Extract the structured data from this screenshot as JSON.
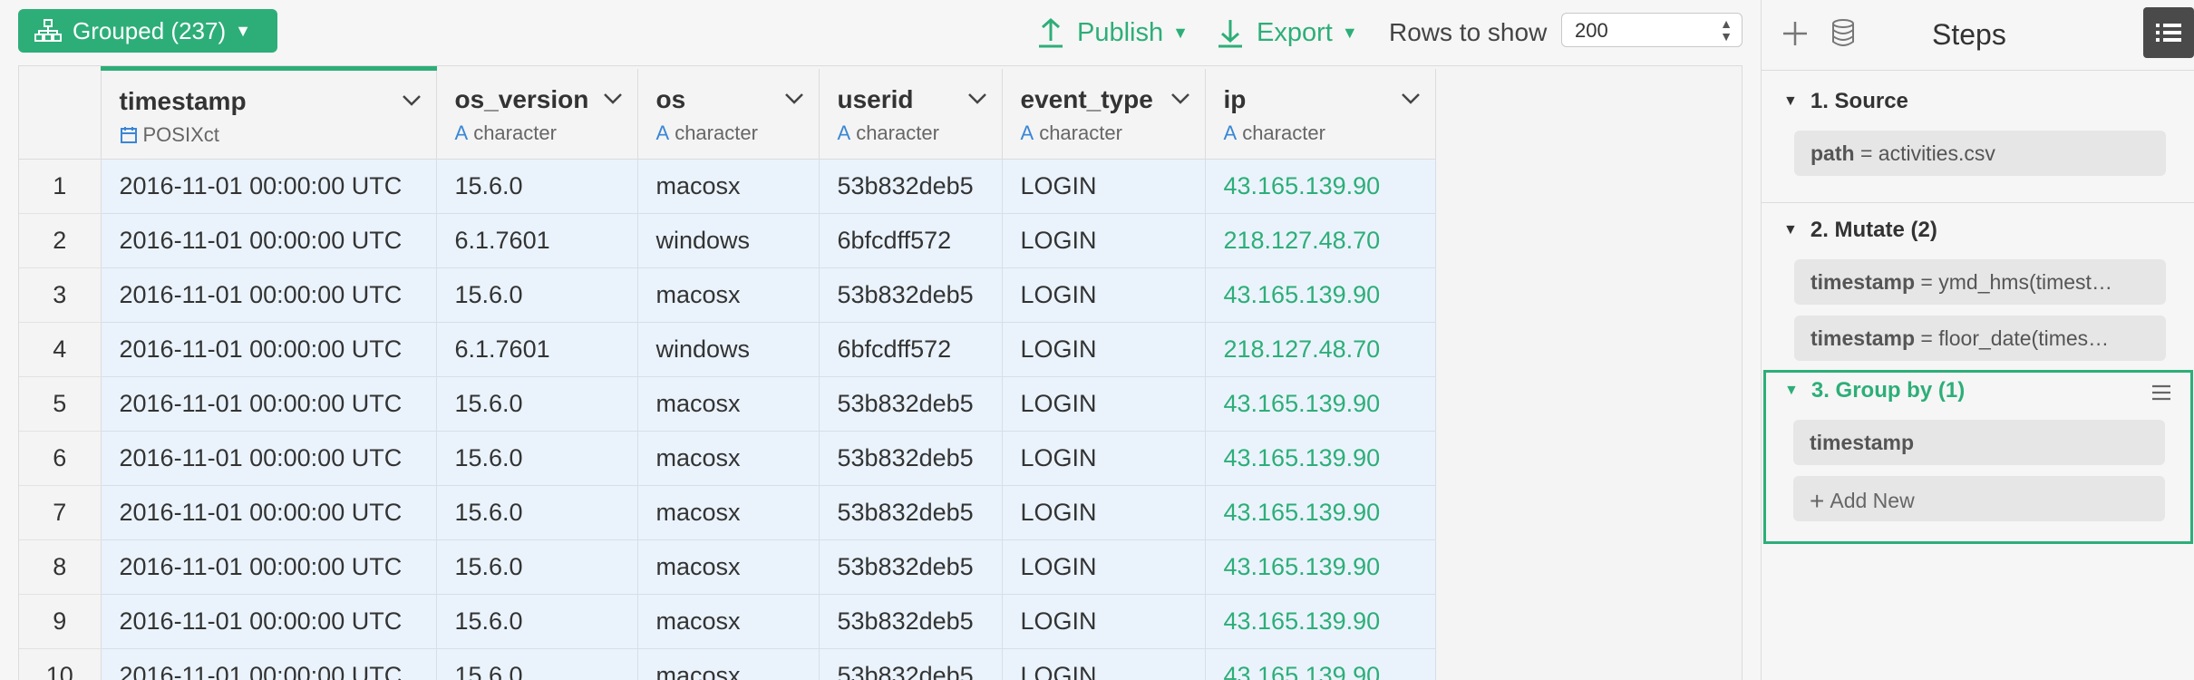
{
  "toolbar": {
    "grouped_label": "Grouped (237)",
    "publish_label": "Publish",
    "export_label": "Export",
    "rows_label": "Rows to show",
    "rows_value": "200"
  },
  "table": {
    "columns": [
      {
        "name": "timestamp",
        "type": "POSIXct",
        "type_icon": "calendar-icon"
      },
      {
        "name": "os_version",
        "type": "character",
        "type_icon": "character-icon"
      },
      {
        "name": "os",
        "type": "character",
        "type_icon": "character-icon"
      },
      {
        "name": "userid",
        "type": "character",
        "type_icon": "character-icon"
      },
      {
        "name": "event_type",
        "type": "character",
        "type_icon": "character-icon"
      },
      {
        "name": "ip",
        "type": "character",
        "type_icon": "character-icon"
      }
    ],
    "rows": [
      [
        "1",
        "2016-11-01 00:00:00 UTC",
        "15.6.0",
        "macosx",
        "53b832deb5",
        "LOGIN",
        "43.165.139.90"
      ],
      [
        "2",
        "2016-11-01 00:00:00 UTC",
        "6.1.7601",
        "windows",
        "6bfcdff572",
        "LOGIN",
        "218.127.48.70"
      ],
      [
        "3",
        "2016-11-01 00:00:00 UTC",
        "15.6.0",
        "macosx",
        "53b832deb5",
        "LOGIN",
        "43.165.139.90"
      ],
      [
        "4",
        "2016-11-01 00:00:00 UTC",
        "6.1.7601",
        "windows",
        "6bfcdff572",
        "LOGIN",
        "218.127.48.70"
      ],
      [
        "5",
        "2016-11-01 00:00:00 UTC",
        "15.6.0",
        "macosx",
        "53b832deb5",
        "LOGIN",
        "43.165.139.90"
      ],
      [
        "6",
        "2016-11-01 00:00:00 UTC",
        "15.6.0",
        "macosx",
        "53b832deb5",
        "LOGIN",
        "43.165.139.90"
      ],
      [
        "7",
        "2016-11-01 00:00:00 UTC",
        "15.6.0",
        "macosx",
        "53b832deb5",
        "LOGIN",
        "43.165.139.90"
      ],
      [
        "8",
        "2016-11-01 00:00:00 UTC",
        "15.6.0",
        "macosx",
        "53b832deb5",
        "LOGIN",
        "43.165.139.90"
      ],
      [
        "9",
        "2016-11-01 00:00:00 UTC",
        "15.6.0",
        "macosx",
        "53b832deb5",
        "LOGIN",
        "43.165.139.90"
      ],
      [
        "10",
        "2016-11-01 00:00:00 UTC",
        "15.6.0",
        "macosx",
        "53b832deb5",
        "LOGIN",
        "43.165.139.90"
      ]
    ]
  },
  "steps": {
    "title": "Steps",
    "source": {
      "header": "1. Source",
      "item_key": "path",
      "item_value": " = activities.csv"
    },
    "mutate": {
      "header": "2. Mutate (2)",
      "items": [
        {
          "key": "timestamp",
          "value": " = ymd_hms(timest…"
        },
        {
          "key": "timestamp",
          "value": " = floor_date(times…"
        }
      ]
    },
    "group_by": {
      "header": "3. Group by (1)",
      "item": "timestamp",
      "add_new": "Add New"
    }
  },
  "colors": {
    "accent": "#2dae78",
    "row_bg": "#eaf3fc",
    "type_icon": "#3a86d6",
    "list_button_bg": "#4a4a4a"
  }
}
